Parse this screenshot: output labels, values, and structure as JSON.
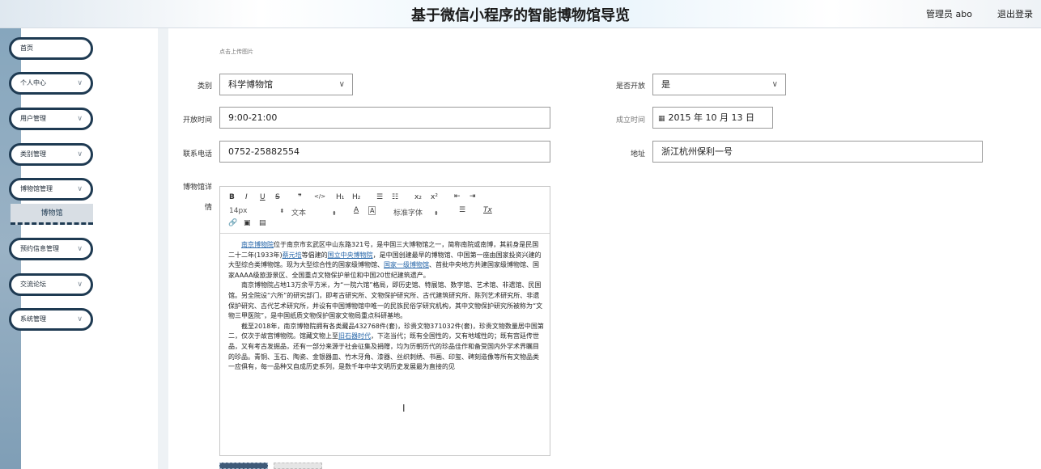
{
  "header": {
    "title": "基于微信小程序的智能博物馆导览",
    "user": "管理员 abo",
    "logout": "退出登录"
  },
  "sidebar": {
    "items": [
      {
        "label": "首页",
        "has_arrow": false
      },
      {
        "label": "个人中心",
        "has_arrow": true
      },
      {
        "label": "用户管理",
        "has_arrow": true
      },
      {
        "label": "类别管理",
        "has_arrow": true
      },
      {
        "label": "博物馆管理",
        "has_arrow": true
      },
      {
        "label": "预约信息管理",
        "has_arrow": true
      },
      {
        "label": "交流论坛",
        "has_arrow": true
      },
      {
        "label": "系统管理",
        "has_arrow": true
      }
    ],
    "submenu_label": "博物馆",
    "arrow": "∨"
  },
  "form": {
    "upload_hint": "点击上传图片",
    "category": {
      "label": "类别",
      "value": "科学博物馆"
    },
    "is_open": {
      "label": "是否开放",
      "value": "是"
    },
    "open_time": {
      "label": "开放时间",
      "value": "9:00-21:00"
    },
    "founded": {
      "label": "成立时间",
      "value": "2015 年 10 月 13 日"
    },
    "phone": {
      "label": "联系电话",
      "value": "0752-25882554"
    },
    "address": {
      "label": "地址",
      "value": "浙江杭州保利一号"
    },
    "detail_label_1": "博物馆详",
    "detail_label_2": "情"
  },
  "editor": {
    "toolbar": {
      "bold": "B",
      "italic": "I",
      "underline": "U",
      "strike": "S",
      "quote": "❞",
      "code": "</>",
      "h1": "H₁",
      "h2": "H₂",
      "ol": "☰",
      "ul": "☷",
      "sub": "x₂",
      "sup": "x²",
      "outdent": "⇤",
      "indent": "⇥",
      "size": "14px",
      "format": "文本",
      "color": "A",
      "bg": "A",
      "font": "标准字体",
      "align": "☰",
      "clear": "Tx",
      "link": "🔗",
      "image": "▣",
      "video": "▤",
      "select_arrow": "⬍"
    },
    "p1": {
      "a": "南京博物院",
      "b": "位于南京市玄武区中山东路321号，是中国三大博物馆之一，简称南院或南博，其前身是民国二十二年(1933年)",
      "c": "蔡元培",
      "d": "等倡建的",
      "e": "国立中央博物院",
      "f": "，是中国创建最早的博物馆、中国第一座由国家投资兴建的大型综合类博物馆。现为大型综合性的国家级博物馆、",
      "g": "国家一级博物馆",
      "h": "、首批中央地方共建国家级博物馆、国家AAAA级旅游景区、全国重点文物保护单位和中国20世纪建筑遗产。"
    },
    "p2": "南京博物院占地13万余平方米，为“一院六馆”格局，即历史馆、特展馆、数字馆、艺术馆、非遗馆、民国馆。另全院设“六所”的研究部门，即考古研究所、文物保护研究所、古代建筑研究所、陈列艺术研究所、非遗保护研究、古代艺术研究所，并设有中国博物馆中唯一的民族民俗学研究机构，其中文物保护研究所被称为“文物三甲医院”，是中国纸质文物保护国家文物局重点科研基地。",
    "p3": {
      "a": "截至2018年，南京博物院拥有各类藏品432768件(套)，珍贵文物371032件(套)，珍贵文物数量居中国第二，仅次于故宫博物院。馆藏文物上至",
      "b": "旧石器时代",
      "c": "，下迄当代；既有全国性的，又有地域性的；既有宫廷传世品，又有考古发掘品，还有一部分来源于社会征集及捐赠，均为历朝历代的珍品佳作和备受国内外学术界瞩目的珍品。青铜、玉石、陶瓷、金银器皿、竹木牙角、漆器、丝织刺绣、书画、印玺、碑刻造像等所有文物品类一应俱有，每一品种又自成历史系列，是数千年中华文明历史发展最为直接的见"
    },
    "cursor": "I"
  }
}
